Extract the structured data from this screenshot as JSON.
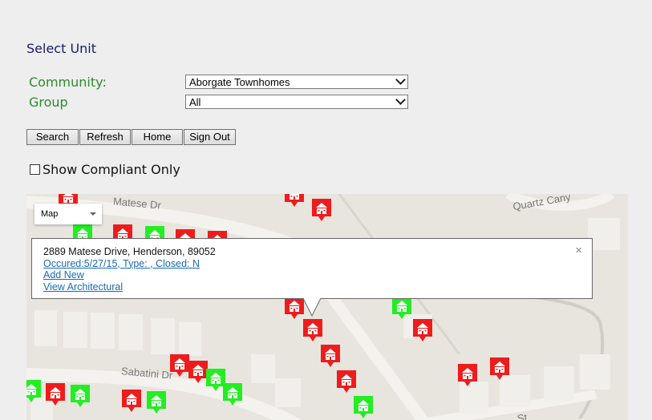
{
  "page": {
    "title": "Select Unit"
  },
  "filters": {
    "community_label": "Community:",
    "community_value": "Aborgate Townhomes",
    "group_label": "Group",
    "group_value": "All"
  },
  "buttons": {
    "search": "Search",
    "refresh": "Refresh",
    "home": "Home",
    "sign_out": "Sign Out"
  },
  "checkbox": {
    "label": "Show Compliant Only",
    "checked": false
  },
  "map": {
    "type_control": "Map",
    "streets": [
      "Matese Dr",
      "Quartz Cany",
      "Sabatini Dr",
      "St"
    ],
    "colors": {
      "non_compliant": "#ee1c1c",
      "compliant": "#22ee22",
      "background": "#e8e5de"
    },
    "markers": [
      {
        "status": "non_compliant"
      },
      {
        "status": "non_compliant"
      },
      {
        "status": "non_compliant"
      },
      {
        "status": "compliant"
      },
      {
        "status": "non_compliant"
      },
      {
        "status": "compliant"
      },
      {
        "status": "non_compliant"
      },
      {
        "status": "non_compliant"
      },
      {
        "status": "non_compliant"
      },
      {
        "status": "non_compliant"
      },
      {
        "status": "compliant"
      },
      {
        "status": "non_compliant"
      },
      {
        "status": "non_compliant"
      },
      {
        "status": "non_compliant"
      },
      {
        "status": "non_compliant"
      },
      {
        "status": "non_compliant"
      },
      {
        "status": "compliant"
      },
      {
        "status": "compliant"
      },
      {
        "status": "compliant"
      },
      {
        "status": "non_compliant"
      },
      {
        "status": "compliant"
      },
      {
        "status": "non_compliant"
      },
      {
        "status": "compliant"
      },
      {
        "status": "non_compliant"
      },
      {
        "status": "non_compliant"
      },
      {
        "status": "compliant"
      }
    ]
  },
  "info_window": {
    "address": "2889 Matese Drive, Henderson, 89052",
    "occurrence_link": "Occured:5/27/15, Type: , Closed: N",
    "add_new_link": "Add New",
    "view_architectural_link": "View Architectural",
    "close_symbol": "×"
  }
}
